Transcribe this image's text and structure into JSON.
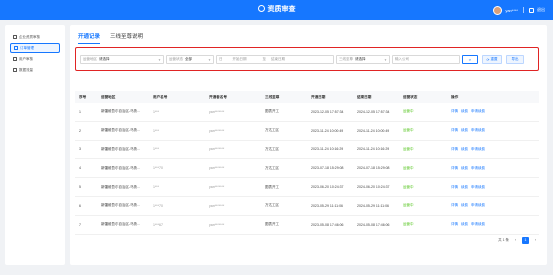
{
  "header": {
    "title": "资质审查",
    "username": "yan****",
    "logout": "退出"
  },
  "sidebar": {
    "items": [
      {
        "label": "企业资质审核",
        "active": false
      },
      {
        "label": "订单管理",
        "active": true
      },
      {
        "label": "用户审核",
        "active": false
      },
      {
        "label": "数据流量",
        "active": false
      }
    ]
  },
  "tabs": [
    {
      "label": "开通记录",
      "active": true
    },
    {
      "label": "三线至尊说明",
      "active": false
    }
  ],
  "filters": {
    "box1": {
      "label": "运营地区",
      "value": "请选择"
    },
    "box2": {
      "label": "运营状态",
      "value": "全部"
    },
    "date_range": {
      "label": "日",
      "start": "开始日期",
      "sep": "至",
      "end": "结束日期"
    },
    "box3": {
      "label": "三线至尊",
      "value": "请选择"
    },
    "search_placeholder": "输入公司",
    "reset_label": "重置",
    "export_label": "导出"
  },
  "table": {
    "columns": [
      "序号",
      "运营地区",
      "用户名号",
      "开通者名号",
      "三线至尊",
      "开通日期",
      "结束日期",
      "运营状态",
      "操作"
    ],
    "rows": [
      {
        "no": "1",
        "region": "新疆维吾尔自治区-乌鲁...",
        "user": "1***",
        "opener": "yan*******",
        "plan": "图表开工",
        "start": "2023-12-05 17:57:34",
        "end": "2024-12-05 17:57:34",
        "status": "运营中"
      },
      {
        "no": "2",
        "region": "新疆维吾尔自治区-乌鲁...",
        "user": "1***",
        "opener": "yan*******",
        "plan": "万达工区",
        "start": "2023-11-24 10:00:49",
        "end": "2024-11-24 10:00:49",
        "status": "运营中"
      },
      {
        "no": "3",
        "region": "新疆维吾尔自治区-乌鲁...",
        "user": "1***",
        "opener": "yan*******",
        "plan": "万达工区",
        "start": "2023-11-24 10:16:29",
        "end": "2024-11-24 10:16:29",
        "status": "运营中"
      },
      {
        "no": "4",
        "region": "新疆维吾尔自治区-乌鲁...",
        "user": "1***70",
        "opener": "yan*******",
        "plan": "万达工区",
        "start": "2023-07-18 15:29:08",
        "end": "2024-07-18 15:29:08",
        "status": "运营中"
      },
      {
        "no": "5",
        "region": "新疆维吾尔自治区-乌鲁...",
        "user": "1***",
        "opener": "yan*******",
        "plan": "图表开工",
        "start": "2023-06-20 10:24:37",
        "end": "2024-06-20 10:24:37",
        "status": "运营中"
      },
      {
        "no": "6",
        "region": "新疆维吾尔自治区-乌鲁...",
        "user": "1***70",
        "opener": "yan*******",
        "plan": "万达工区",
        "start": "2023-05-29 11:11:06",
        "end": "2024-05-29 11:11:06",
        "status": "运营中"
      },
      {
        "no": "7",
        "region": "新疆维吾尔自治区-乌鲁...",
        "user": "1***67",
        "opener": "yan*******",
        "plan": "图表开工",
        "start": "2023-05-08 17:46:06",
        "end": "2024-05-08 17:46:06",
        "status": "运营中"
      }
    ],
    "op_labels": [
      "详情",
      "续费",
      "申请续费"
    ]
  },
  "pager": {
    "total": "共 1 条",
    "current": "1",
    "prev": "‹",
    "next": "›"
  },
  "colors": {
    "primary": "#1677ff",
    "highlight": "#e02424",
    "status_ok": "#52c41a"
  }
}
